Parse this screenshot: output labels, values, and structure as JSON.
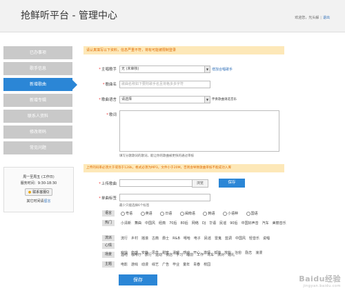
{
  "header": {
    "logo": "抢鲜听平台 - 管理中心",
    "welcome": "欢迎您，光头解",
    "exit": "退出"
  },
  "sidebar": {
    "items": [
      {
        "label": "已办事项"
      },
      {
        "label": "歌手信息"
      },
      {
        "label": "新增歌曲"
      },
      {
        "label": "新增专辑"
      },
      {
        "label": "联系人资料"
      },
      {
        "label": "修改密码"
      },
      {
        "label": "常见问题"
      }
    ],
    "active_index": 2
  },
  "service": {
    "hours": "周一至周五 (工作日)",
    "time": "服务时间：9:30-18:30",
    "qq_button": "联系客服Q",
    "other_prefix": "其它时间请",
    "other_link": "留言"
  },
  "form": {
    "notice1": "请认真填写以下资料，信息严重不符，将有可能被限制登录",
    "singer": {
      "label": "主唱歌手",
      "value": "无 (未审核)",
      "link": "增加合唱歌手"
    },
    "song_name": {
      "label": "歌曲名",
      "placeholder": "歌曲名称如下要附歌手名且将格多多字符"
    },
    "language": {
      "label": "歌曲语言",
      "value": "请选择",
      "note": "伴奏歌曲请选音乐"
    },
    "lyrics": {
      "label": "歌词",
      "hint": "填写分歌歌词的歌词，能让你的歌曲被更快的通过审核"
    },
    "notice2": "上传的码率必须大于或等于128k，格式必须为MP3，文件小于20M，否则会导致歌曲审核不能成功入库",
    "upload": {
      "label": "上传歌曲",
      "browse": "浏览",
      "save": "保存"
    },
    "tags": {
      "label": "单曲标签",
      "hint": "最少只能选择6个标签"
    },
    "submit": "保存"
  },
  "tag_groups": [
    {
      "name": "语言",
      "values": [
        "粤语",
        "英语",
        "日语",
        "闽南语",
        "韩语",
        "小语种",
        "国语"
      ],
      "radio": true
    },
    {
      "name": "热门",
      "values": [
        "小清新",
        "舞曲",
        "中国风",
        "经典",
        "70后",
        "80后",
        "网络",
        "DJ",
        "华语",
        "民谣",
        "90后",
        "中国好声音",
        "汽车",
        "美丽音乐"
      ]
    },
    {
      "name": "流派",
      "values": [
        "流行",
        "乡村",
        "摇滚",
        "古典",
        "爵士",
        "R&B",
        "嘻哈",
        "电子",
        "民谣",
        "雷鬼",
        "蓝调",
        "中国风",
        "轻音乐",
        "说唱"
      ]
    },
    {
      "name": "心情",
      "values": [
        "欢快",
        "伤感",
        "安静",
        "思念",
        "甜蜜",
        "温暖",
        "感动",
        "开心",
        "激情",
        "孤独",
        "放松",
        "治愈",
        "励志",
        "浪漫"
      ]
    },
    {
      "name": "场景",
      "values": [
        "酒吧",
        "咖啡厅",
        "旅行",
        "运动",
        "夜店",
        "学习",
        "睡前",
        "工作",
        "驾车",
        "派对",
        "婚礼"
      ]
    },
    {
      "name": "主题",
      "values": [
        "电影",
        "游戏",
        "动漫",
        "综艺",
        "广告",
        "毕业",
        "童年",
        "青春",
        "校园"
      ]
    }
  ],
  "watermark": {
    "main": "Baidu经验",
    "sub": "jingyan.baidu.com"
  }
}
